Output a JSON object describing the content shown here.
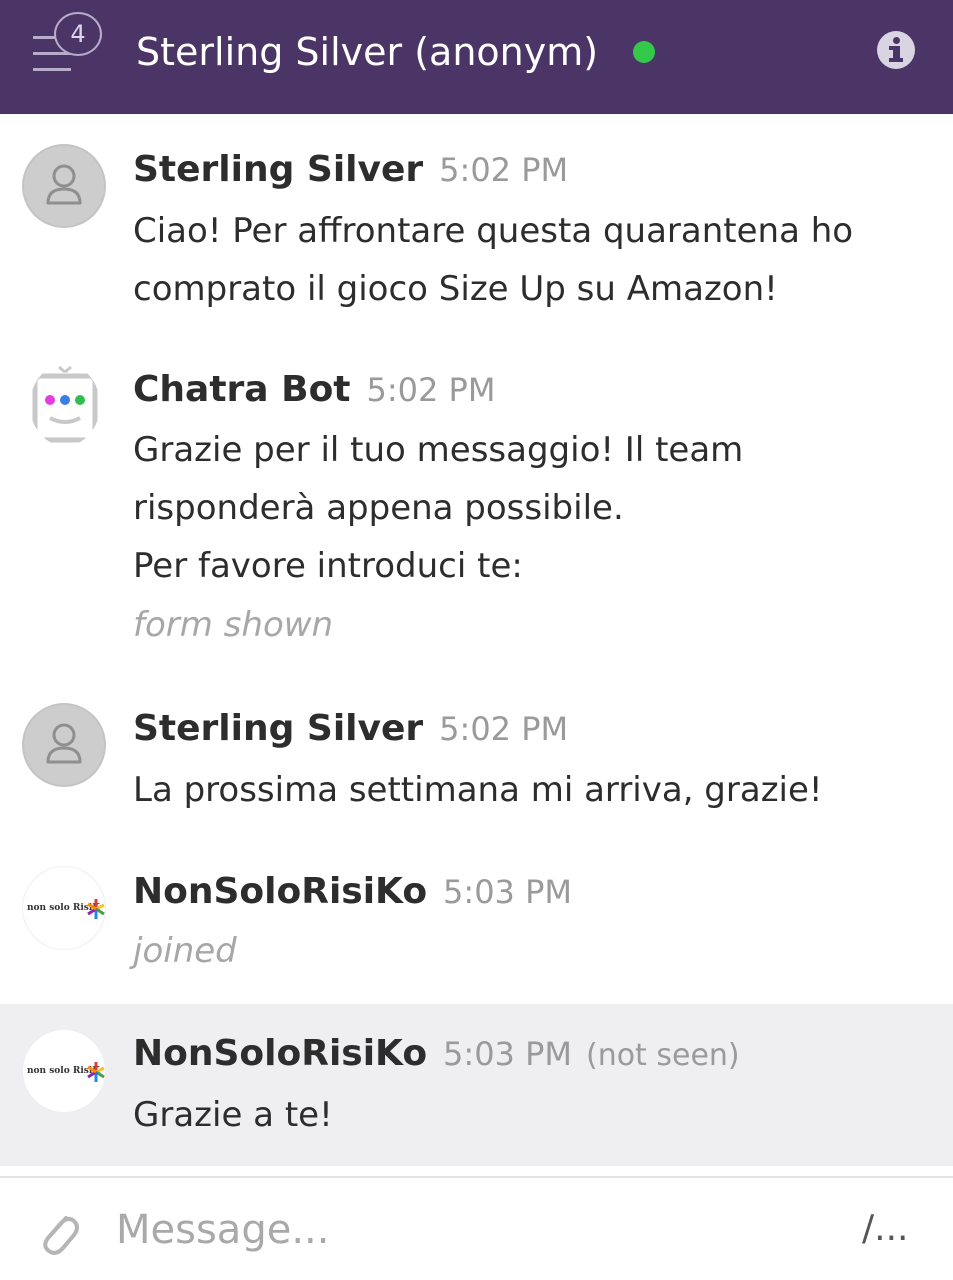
{
  "header": {
    "unread_count": "4",
    "title": "Sterling Silver (anonym)",
    "status": "online",
    "menu_icon": "menu-icon",
    "info_icon": "info-icon"
  },
  "messages": [
    {
      "author": "Sterling Silver",
      "time": "5:02 PM",
      "avatar": "user-icon",
      "lines": [
        "Ciao! Per affrontare questa quarantena ho",
        "comprato il gioco Size Up su Amazon!"
      ]
    },
    {
      "author": "Chatra Bot",
      "time": "5:02 PM",
      "avatar": "bot-icon",
      "lines": [
        "Grazie per il tuo messaggio! Il team",
        "risponderà appena possibile.",
        "Per favore introduci te:"
      ],
      "system": "form shown"
    },
    {
      "author": "Sterling Silver",
      "time": "5:02 PM",
      "avatar": "user-icon",
      "lines": [
        "La prossima settimana mi arriva, grazie!"
      ]
    },
    {
      "author": "NonSoloRisiKo",
      "time": "5:03 PM",
      "avatar_text": "non solo RisiK",
      "system": "joined"
    },
    {
      "author": "NonSoloRisiKo",
      "time": "5:03 PM",
      "status": "(not seen)",
      "avatar_text": "non solo RisiK",
      "lines": [
        "Grazie a te!"
      ]
    }
  ],
  "composer": {
    "placeholder": "Message...",
    "commands_label": "/...",
    "attach_icon": "paperclip-icon"
  },
  "colors": {
    "header_bg": "#4a3566",
    "online": "#34c84a",
    "highlight_bg": "#efeff1"
  }
}
